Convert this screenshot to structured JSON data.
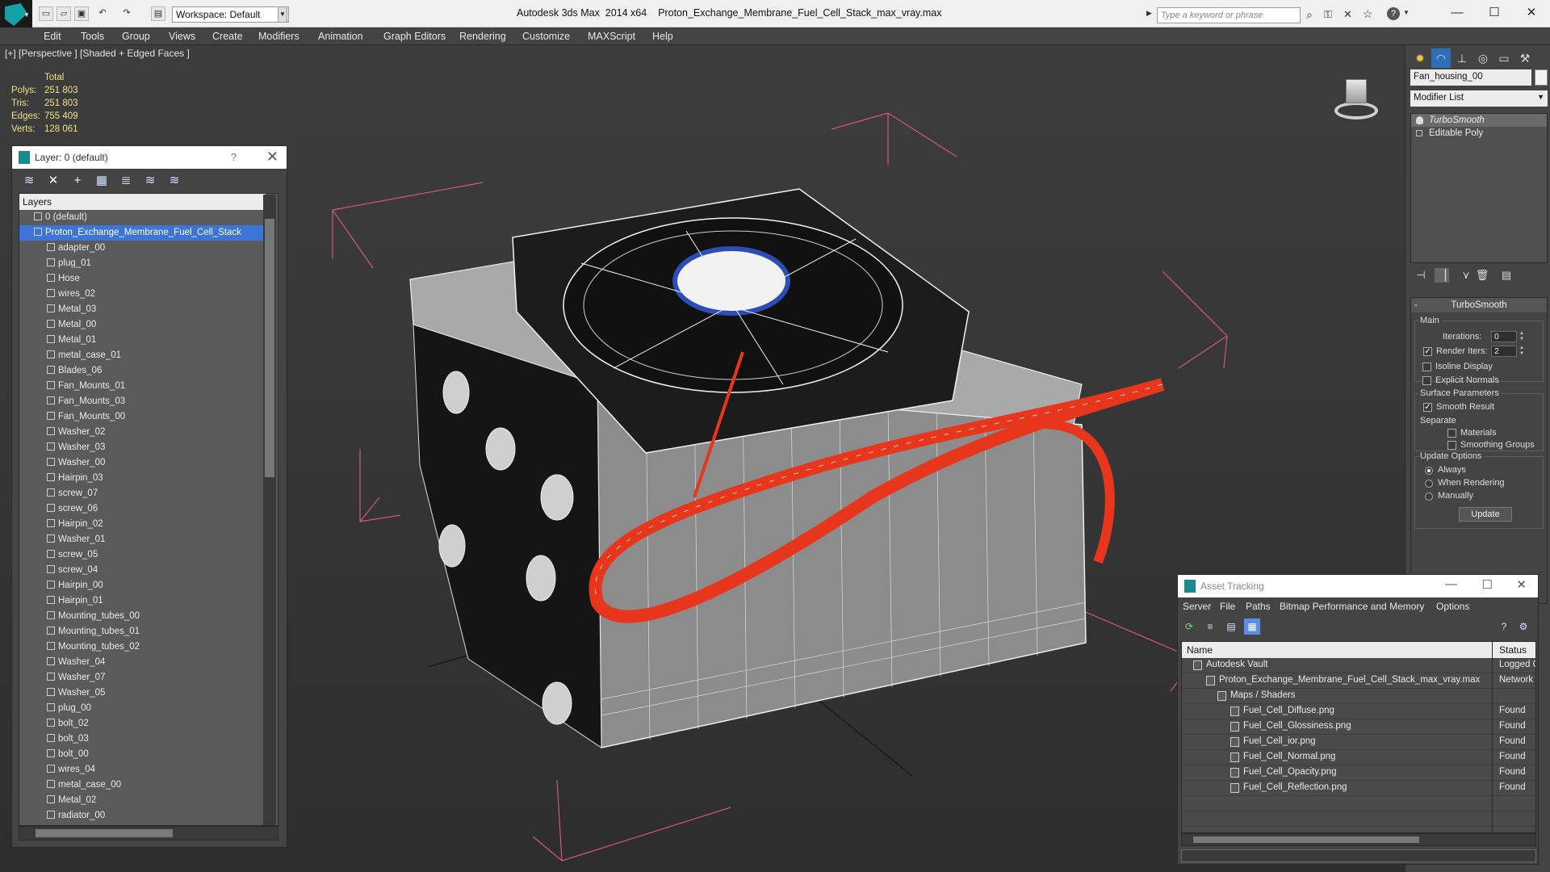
{
  "titlebar": {
    "workspace": "Workspace: Default",
    "app_name": "Autodesk 3ds Max  2014 x64",
    "file_name": "Proton_Exchange_Membrane_Fuel_Cell_Stack_max_vray.max",
    "search_placeholder": "Type a keyword or phrase",
    "min": "—",
    "max": "☐",
    "close": "✕"
  },
  "menu": [
    "Edit",
    "Tools",
    "Group",
    "Views",
    "Create",
    "Modifiers",
    "Animation",
    "Graph Editors",
    "Rendering",
    "Customize",
    "MAXScript",
    "Help"
  ],
  "viewport": {
    "label": "[+] [Perspective ] [Shaded + Edged Faces ]",
    "stats_header": "Total",
    "stats": [
      {
        "label": "Polys:",
        "value": "251 803"
      },
      {
        "label": "Tris:",
        "value": "251 803"
      },
      {
        "label": "Edges:",
        "value": "755 409"
      },
      {
        "label": "Verts:",
        "value": "128 061"
      }
    ]
  },
  "layer_panel": {
    "title": "Layer: 0 (default)",
    "help": "?",
    "close": "✕",
    "column_header": "Layers",
    "default_layer": "0 (default)",
    "selected_layer": "Proton_Exchange_Membrane_Fuel_Cell_Stack",
    "objects": [
      "adapter_00",
      "plug_01",
      "Hose",
      "wires_02",
      "Metal_03",
      "Metal_00",
      "Metal_01",
      "metal_case_01",
      "Blades_06",
      "Fan_Mounts_01",
      "Fan_Mounts_03",
      "Fan_Mounts_00",
      "Washer_02",
      "Washer_03",
      "Washer_00",
      "Hairpin_03",
      "screw_07",
      "screw_06",
      "Hairpin_02",
      "Washer_01",
      "screw_05",
      "screw_04",
      "Hairpin_00",
      "Hairpin_01",
      "Mounting_tubes_00",
      "Mounting_tubes_01",
      "Mounting_tubes_02",
      "Washer_04",
      "Washer_07",
      "Washer_05",
      "plug_00",
      "bolt_02",
      "bolt_03",
      "bolt_00",
      "wires_04",
      "metal_case_00",
      "Metal_02",
      "radiator_00"
    ]
  },
  "command_panel": {
    "object_name": "Fan_housing_00",
    "modifier_list": "Modifier List",
    "stack": [
      "TurboSmooth",
      "Editable Poly"
    ],
    "rollout_title": "TurboSmooth",
    "main_group": "Main",
    "iterations_label": "Iterations:",
    "iterations_value": "0",
    "render_iters_label": "Render Iters:",
    "render_iters_value": "2",
    "isoline_label": "Isoline Display",
    "explicit_normals_label": "Explicit Normals",
    "surface_group": "Surface Parameters",
    "smooth_result_label": "Smooth Result",
    "separate_label": "Separate",
    "materials_label": "Materials",
    "smoothing_groups_label": "Smoothing Groups",
    "update_group": "Update Options",
    "always_label": "Always",
    "when_rendering_label": "When Rendering",
    "manually_label": "Manually",
    "update_button": "Update"
  },
  "asset_tracking": {
    "title": "Asset Tracking",
    "menu": [
      "Server",
      "File",
      "Paths",
      "Bitmap Performance and Memory",
      "Options"
    ],
    "col_name": "Name",
    "col_status": "Status",
    "rows": [
      {
        "name": "Autodesk Vault",
        "status": "Logged Ou"
      },
      {
        "name": "Proton_Exchange_Membrane_Fuel_Cell_Stack_max_vray.max",
        "status": "Network Pa"
      },
      {
        "name": "Maps / Shaders",
        "status": ""
      },
      {
        "name": "Fuel_Cell_Diffuse.png",
        "status": "Found"
      },
      {
        "name": "Fuel_Cell_Glossiness.png",
        "status": "Found"
      },
      {
        "name": "Fuel_Cell_ior.png",
        "status": "Found"
      },
      {
        "name": "Fuel_Cell_Normal.png",
        "status": "Found"
      },
      {
        "name": "Fuel_Cell_Opacity.png",
        "status": "Found"
      },
      {
        "name": "Fuel_Cell_Reflection.png",
        "status": "Found"
      }
    ]
  },
  "colors": {
    "selection": "#3c74d8",
    "stats_text": "#f0e28a",
    "hose": "#e8361c",
    "bbox": "#d4587a"
  }
}
